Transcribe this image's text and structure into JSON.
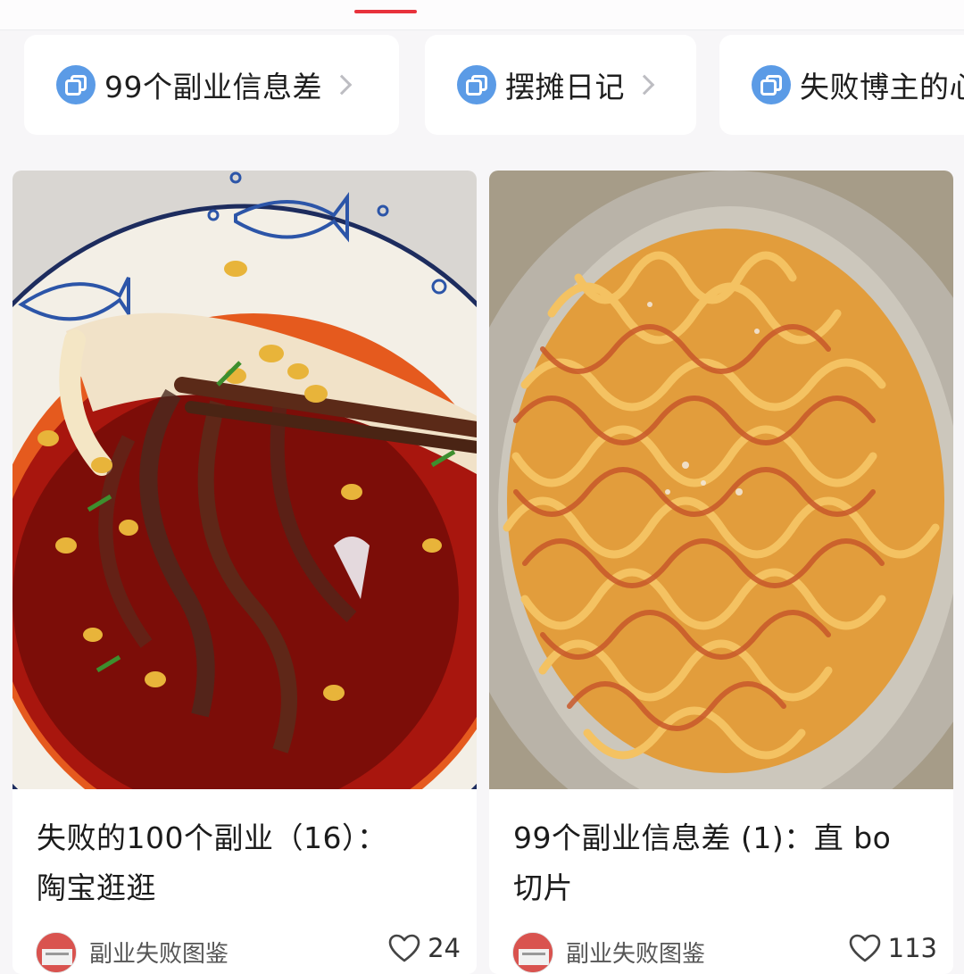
{
  "collections": [
    {
      "label": "99个副业信息差",
      "icon": "stack-icon"
    },
    {
      "label": "摆摊日记",
      "icon": "stack-icon"
    },
    {
      "label": "失败博主的心",
      "icon": "stack-icon"
    }
  ],
  "feed": [
    {
      "title_line1": "失败的100个副业（16）：",
      "title_line2": "陶宝逛逛",
      "author": "副业失败图鉴",
      "likes": "24",
      "image": "spicy-glass-noodle-soup"
    },
    {
      "title_line1": "99个副业信息差 (1)：直 bo",
      "title_line2": "切片",
      "author": "副业失败图鉴",
      "likes": "113",
      "image": "spicy-fried-noodles"
    }
  ],
  "colors": {
    "accent": "#e8323c",
    "collection_icon": "#5b9be6",
    "background": "#f7f6f8"
  }
}
